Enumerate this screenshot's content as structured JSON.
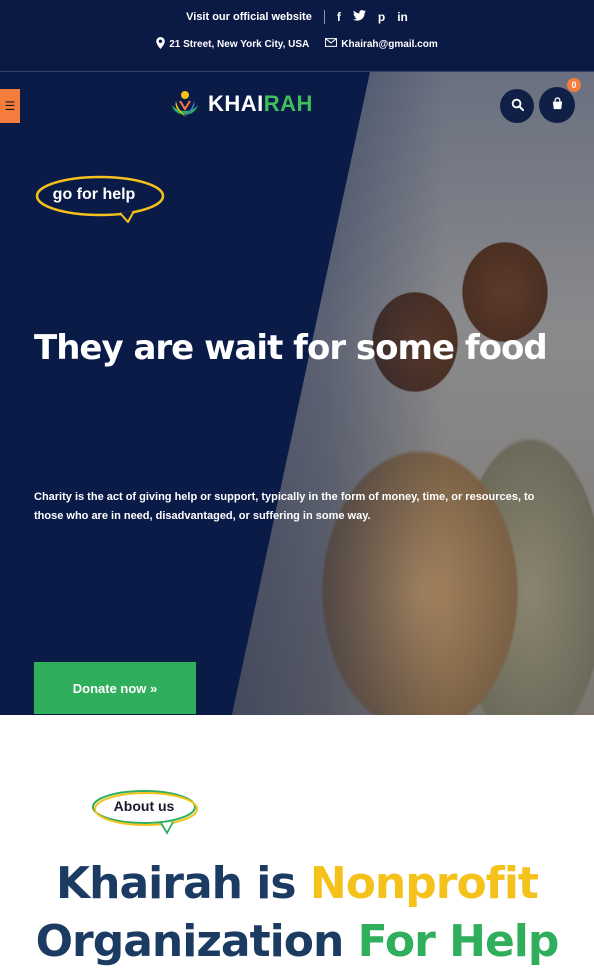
{
  "topbar": {
    "visit_text": "Visit our official website",
    "social": [
      "f",
      "t",
      "p",
      "in"
    ],
    "address": "21 Street, New York City, USA",
    "email": "Khairah@gmail.com"
  },
  "header": {
    "brand_part1": "KHAI",
    "brand_part2": "RAH",
    "cart_count": "0"
  },
  "hero": {
    "badge": "go for help",
    "title": "They are wait for some food",
    "description": "Charity is the act of giving help or support, typically in the form of money, time, or resources, to those who are in need, disadvantaged, or suffering in some way.",
    "cta": "Donate now »"
  },
  "about": {
    "badge": "About us",
    "title_line1_part1": "Khairah is ",
    "title_line1_part2": "Nonprofit",
    "title_line2_part1": "Organization ",
    "title_line2_part2": "For Help"
  },
  "colors": {
    "navy": "#0b1a45",
    "accent_orange": "#f47c3c",
    "green": "#2fae5c",
    "gold": "#f5c21b",
    "title_dark": "#1c3b63"
  },
  "icons": {
    "menu": "hamburger-icon",
    "search": "search-icon",
    "cart": "shopping-bag-icon",
    "location": "location-pin-icon",
    "email": "envelope-icon"
  }
}
